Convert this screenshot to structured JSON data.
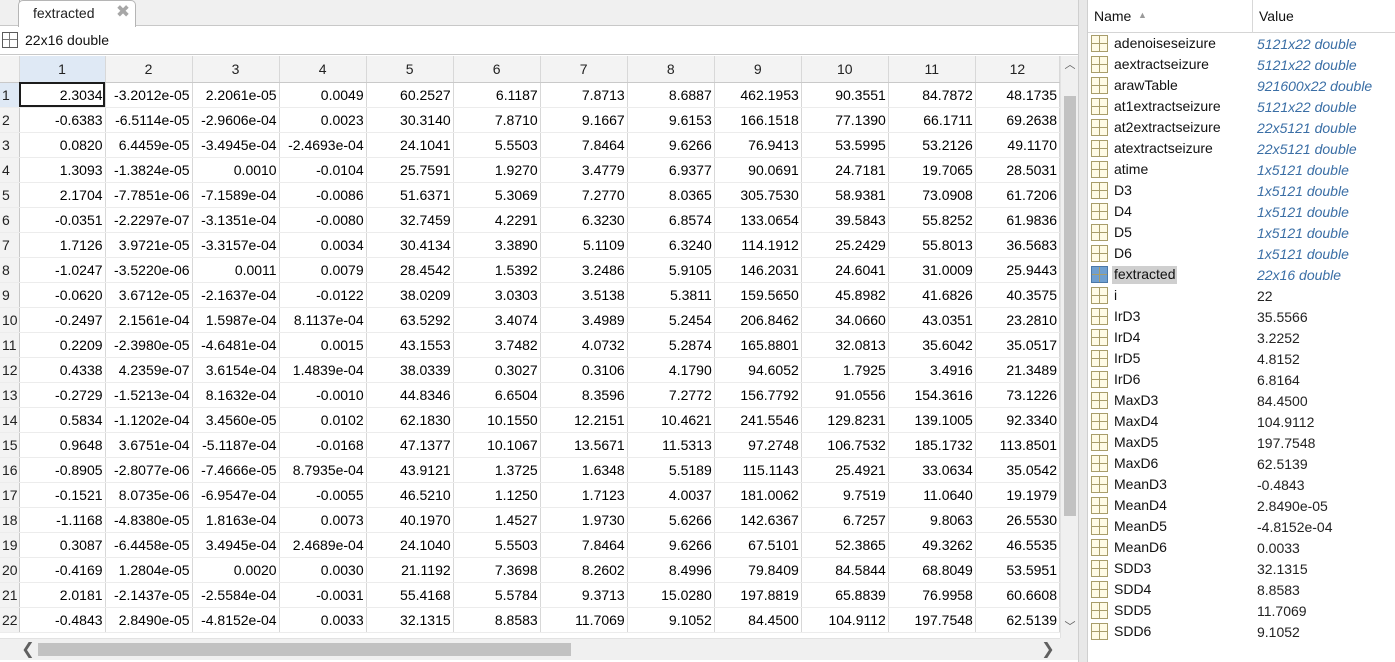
{
  "editor": {
    "tab_label": "fextracted",
    "close_glyph": "✖",
    "info_label": "22x16 double",
    "columns": [
      "1",
      "2",
      "3",
      "4",
      "5",
      "6",
      "7",
      "8",
      "9",
      "10",
      "11",
      "12"
    ],
    "rows": [
      {
        "n": "1",
        "cells": [
          "2.3034",
          "-3.2012e-05",
          "2.2061e-05",
          "0.0049",
          "60.2527",
          "6.1187",
          "7.8713",
          "8.6887",
          "462.1953",
          "90.3551",
          "84.7872",
          "48.1735"
        ]
      },
      {
        "n": "2",
        "cells": [
          "-0.6383",
          "-6.5114e-05",
          "-2.9606e-04",
          "0.0023",
          "30.3140",
          "7.8710",
          "9.1667",
          "9.6153",
          "166.1518",
          "77.1390",
          "66.1711",
          "69.2638"
        ]
      },
      {
        "n": "3",
        "cells": [
          "0.0820",
          "6.4459e-05",
          "-3.4945e-04",
          "-2.4693e-04",
          "24.1041",
          "5.5503",
          "7.8464",
          "9.6266",
          "76.9413",
          "53.5995",
          "53.2126",
          "49.1170"
        ]
      },
      {
        "n": "4",
        "cells": [
          "1.3093",
          "-1.3824e-05",
          "0.0010",
          "-0.0104",
          "25.7591",
          "1.9270",
          "3.4779",
          "6.9377",
          "90.0691",
          "24.7181",
          "19.7065",
          "28.5031"
        ]
      },
      {
        "n": "5",
        "cells": [
          "2.1704",
          "-7.7851e-06",
          "-7.1589e-04",
          "-0.0086",
          "51.6371",
          "5.3069",
          "7.2770",
          "8.0365",
          "305.7530",
          "58.9381",
          "73.0908",
          "61.7206"
        ]
      },
      {
        "n": "6",
        "cells": [
          "-0.0351",
          "-2.2297e-07",
          "-3.1351e-04",
          "-0.0080",
          "32.7459",
          "4.2291",
          "6.3230",
          "6.8574",
          "133.0654",
          "39.5843",
          "55.8252",
          "61.9836"
        ]
      },
      {
        "n": "7",
        "cells": [
          "1.7126",
          "3.9721e-05",
          "-3.3157e-04",
          "0.0034",
          "30.4134",
          "3.3890",
          "5.1109",
          "6.3240",
          "114.1912",
          "25.2429",
          "55.8013",
          "36.5683"
        ]
      },
      {
        "n": "8",
        "cells": [
          "-1.0247",
          "-3.5220e-06",
          "0.0011",
          "0.0079",
          "28.4542",
          "1.5392",
          "3.2486",
          "5.9105",
          "146.2031",
          "24.6041",
          "31.0009",
          "25.9443"
        ]
      },
      {
        "n": "9",
        "cells": [
          "-0.0620",
          "3.6712e-05",
          "-2.1637e-04",
          "-0.0122",
          "38.0209",
          "3.0303",
          "3.5138",
          "5.3811",
          "159.5650",
          "45.8982",
          "41.6826",
          "40.3575"
        ]
      },
      {
        "n": "10",
        "cells": [
          "-0.2497",
          "2.1561e-04",
          "1.5987e-04",
          "8.1137e-04",
          "63.5292",
          "3.4074",
          "3.4989",
          "5.2454",
          "206.8462",
          "34.0660",
          "43.0351",
          "23.2810"
        ]
      },
      {
        "n": "11",
        "cells": [
          "0.2209",
          "-2.3980e-05",
          "-4.6481e-04",
          "0.0015",
          "43.1553",
          "3.7482",
          "4.0732",
          "5.2874",
          "165.8801",
          "32.0813",
          "35.6042",
          "35.0517"
        ]
      },
      {
        "n": "12",
        "cells": [
          "0.4338",
          "4.2359e-07",
          "3.6154e-04",
          "1.4839e-04",
          "38.0339",
          "0.3027",
          "0.3106",
          "4.1790",
          "94.6052",
          "1.7925",
          "3.4916",
          "21.3489"
        ]
      },
      {
        "n": "13",
        "cells": [
          "-0.2729",
          "-1.5213e-04",
          "8.1632e-04",
          "-0.0010",
          "44.8346",
          "6.6504",
          "8.3596",
          "7.2772",
          "156.7792",
          "91.0556",
          "154.3616",
          "73.1226"
        ]
      },
      {
        "n": "14",
        "cells": [
          "0.5834",
          "-1.1202e-04",
          "3.4560e-05",
          "0.0102",
          "62.1830",
          "10.1550",
          "12.2151",
          "10.4621",
          "241.5546",
          "129.8231",
          "139.1005",
          "92.3340"
        ]
      },
      {
        "n": "15",
        "cells": [
          "0.9648",
          "3.6751e-04",
          "-5.1187e-04",
          "-0.0168",
          "47.1377",
          "10.1067",
          "13.5671",
          "11.5313",
          "97.2748",
          "106.7532",
          "185.1732",
          "113.8501"
        ]
      },
      {
        "n": "16",
        "cells": [
          "-0.8905",
          "-2.8077e-06",
          "-7.4666e-05",
          "8.7935e-04",
          "43.9121",
          "1.3725",
          "1.6348",
          "5.5189",
          "115.1143",
          "25.4921",
          "33.0634",
          "35.0542"
        ]
      },
      {
        "n": "17",
        "cells": [
          "-0.1521",
          "8.0735e-06",
          "-6.9547e-04",
          "-0.0055",
          "46.5210",
          "1.1250",
          "1.7123",
          "4.0037",
          "181.0062",
          "9.7519",
          "11.0640",
          "19.1979"
        ]
      },
      {
        "n": "18",
        "cells": [
          "-1.1168",
          "-4.8380e-05",
          "1.8163e-04",
          "0.0073",
          "40.1970",
          "1.4527",
          "1.9730",
          "5.6266",
          "142.6367",
          "6.7257",
          "9.8063",
          "26.5530"
        ]
      },
      {
        "n": "19",
        "cells": [
          "0.3087",
          "-6.4458e-05",
          "3.4945e-04",
          "2.4689e-04",
          "24.1040",
          "5.5503",
          "7.8464",
          "9.6266",
          "67.5101",
          "52.3865",
          "49.3262",
          "46.5535"
        ]
      },
      {
        "n": "20",
        "cells": [
          "-0.4169",
          "1.2804e-05",
          "0.0020",
          "0.0030",
          "21.1192",
          "7.3698",
          "8.2602",
          "8.4996",
          "79.8409",
          "84.5844",
          "68.8049",
          "53.5951"
        ]
      },
      {
        "n": "21",
        "cells": [
          "2.0181",
          "-2.1437e-05",
          "-2.5584e-04",
          "-0.0031",
          "55.4168",
          "5.5784",
          "9.3713",
          "15.0280",
          "197.8819",
          "65.8839",
          "76.9958",
          "60.6608"
        ]
      },
      {
        "n": "22",
        "cells": [
          "-0.4843",
          "2.8490e-05",
          "-4.8152e-04",
          "0.0033",
          "32.1315",
          "8.8583",
          "11.7069",
          "9.1052",
          "84.4500",
          "104.9112",
          "197.7548",
          "62.5139"
        ]
      }
    ]
  },
  "workspace": {
    "name_header": "Name",
    "sort_glyph": "▲",
    "value_header": "Value",
    "variables": [
      {
        "name": "adenoiseseizure",
        "value": "5121x22 double",
        "italic": true
      },
      {
        "name": "aextractseizure",
        "value": "5121x22 double",
        "italic": true
      },
      {
        "name": "arawTable",
        "value": "921600x22 double",
        "italic": true
      },
      {
        "name": "at1extractseizure",
        "value": "5121x22 double",
        "italic": true
      },
      {
        "name": "at2extractseizure",
        "value": "22x5121 double",
        "italic": true
      },
      {
        "name": "atextractseizure",
        "value": "22x5121 double",
        "italic": true
      },
      {
        "name": "atime",
        "value": "1x5121 double",
        "italic": true
      },
      {
        "name": "D3",
        "value": "1x5121 double",
        "italic": true
      },
      {
        "name": "D4",
        "value": "1x5121 double",
        "italic": true
      },
      {
        "name": "D5",
        "value": "1x5121 double",
        "italic": true
      },
      {
        "name": "D6",
        "value": "1x5121 double",
        "italic": true
      },
      {
        "name": "fextracted",
        "value": "22x16 double",
        "italic": true,
        "selected": true
      },
      {
        "name": "i",
        "value": "22",
        "italic": false
      },
      {
        "name": "IrD3",
        "value": "35.5566",
        "italic": false
      },
      {
        "name": "IrD4",
        "value": "3.2252",
        "italic": false
      },
      {
        "name": "IrD5",
        "value": "4.8152",
        "italic": false
      },
      {
        "name": "IrD6",
        "value": "6.8164",
        "italic": false
      },
      {
        "name": "MaxD3",
        "value": "84.4500",
        "italic": false
      },
      {
        "name": "MaxD4",
        "value": "104.9112",
        "italic": false
      },
      {
        "name": "MaxD5",
        "value": "197.7548",
        "italic": false
      },
      {
        "name": "MaxD6",
        "value": "62.5139",
        "italic": false
      },
      {
        "name": "MeanD3",
        "value": "-0.4843",
        "italic": false
      },
      {
        "name": "MeanD4",
        "value": "2.8490e-05",
        "italic": false
      },
      {
        "name": "MeanD5",
        "value": "-4.8152e-04",
        "italic": false
      },
      {
        "name": "MeanD6",
        "value": "0.0033",
        "italic": false
      },
      {
        "name": "SDD3",
        "value": "32.1315",
        "italic": false
      },
      {
        "name": "SDD4",
        "value": "8.8583",
        "italic": false
      },
      {
        "name": "SDD5",
        "value": "11.7069",
        "italic": false
      },
      {
        "name": "SDD6",
        "value": "9.1052",
        "italic": false
      }
    ]
  },
  "scroll": {
    "left_glyph": "❮",
    "right_glyph": "❯",
    "up_glyph": "︿",
    "down_glyph": "﹀"
  },
  "colors": {
    "selection_header": "#dfe9f5",
    "workspace_value_class": "#3a6ea5"
  }
}
